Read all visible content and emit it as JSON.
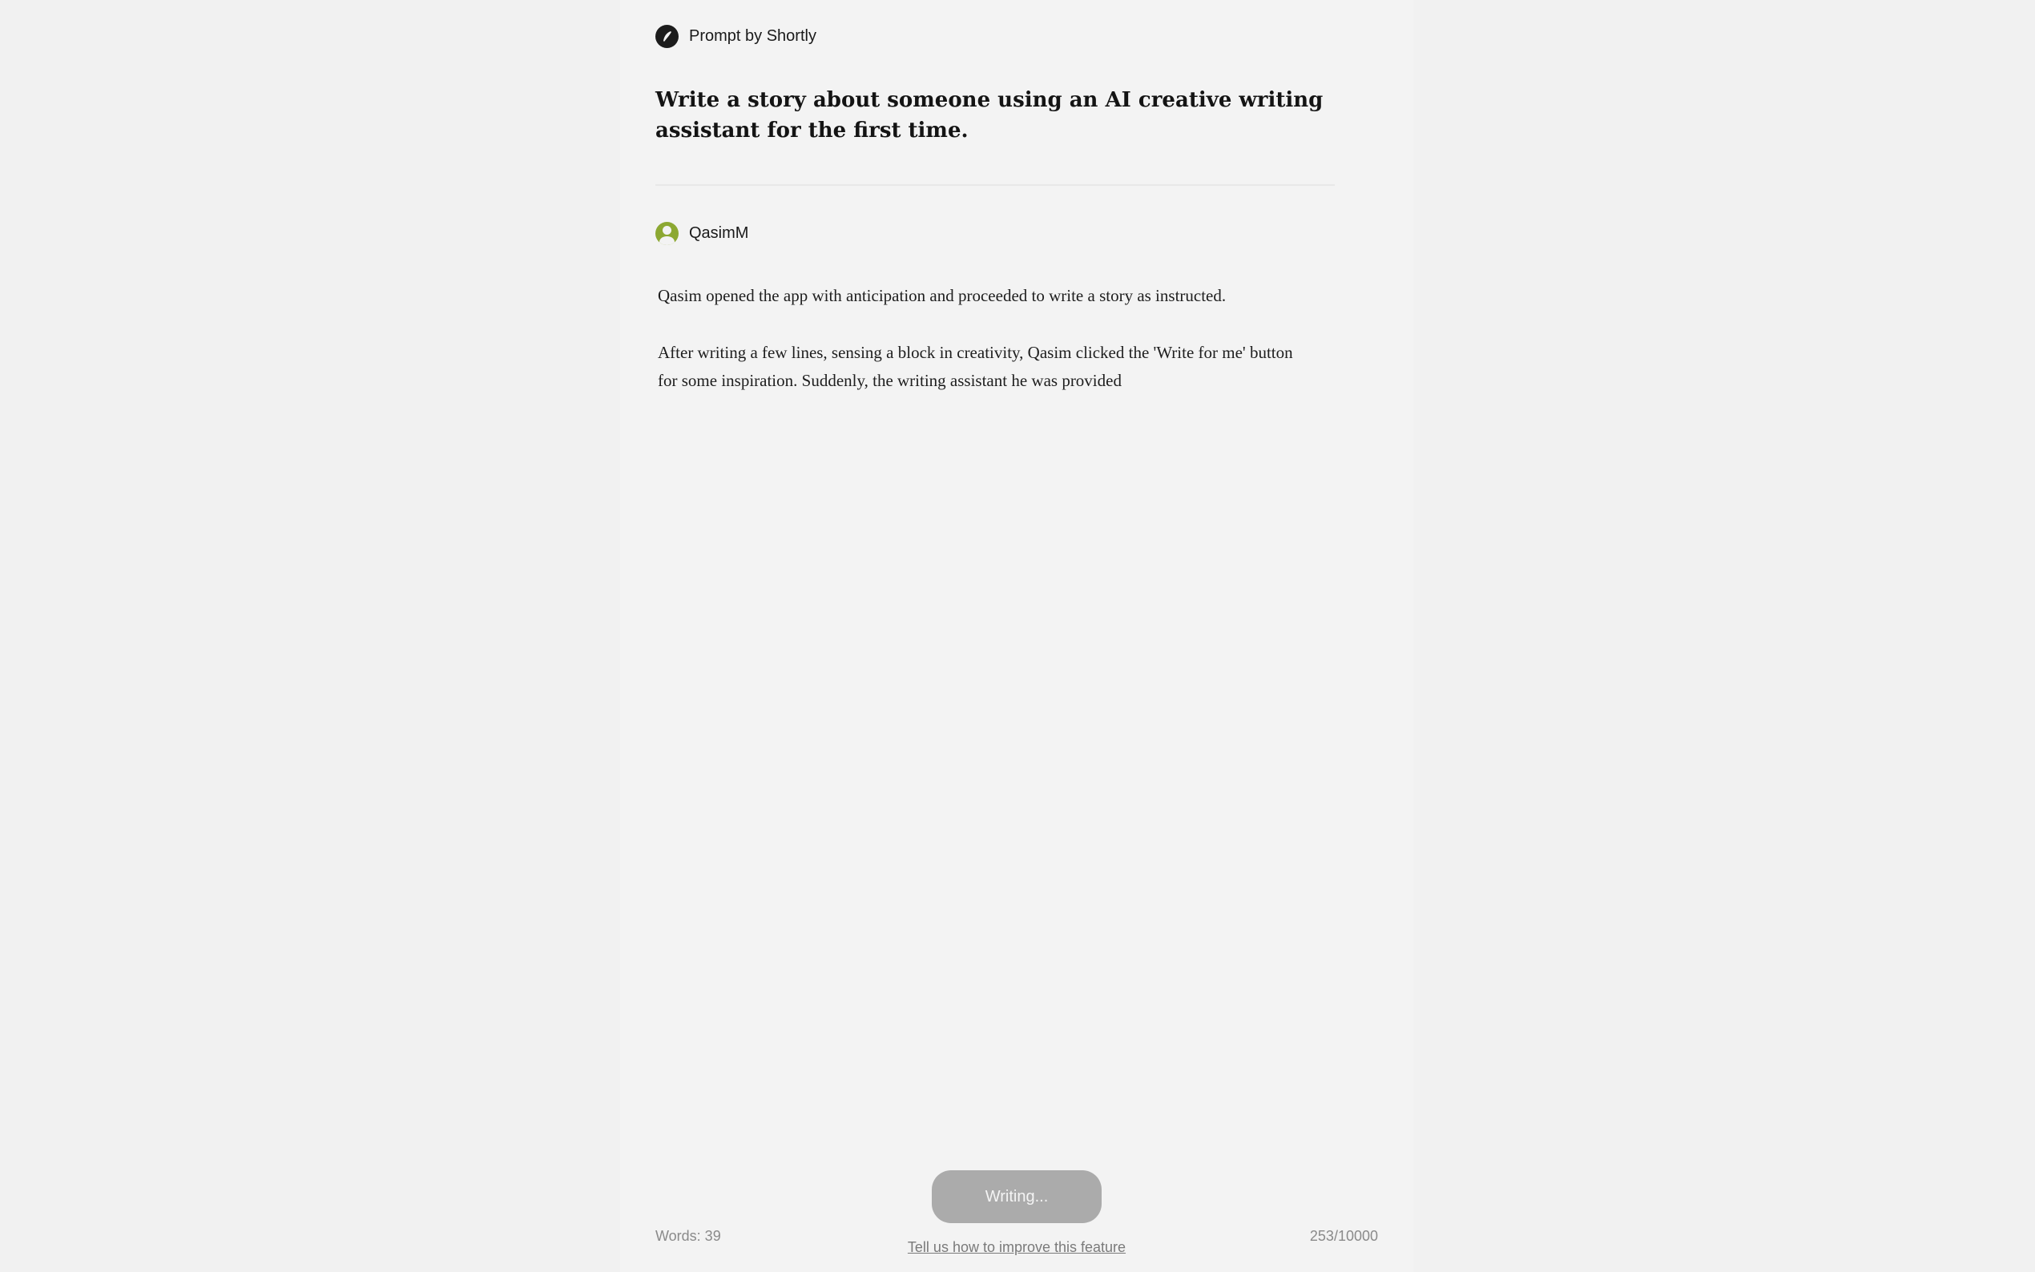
{
  "header": {
    "title": "Prompt by Shortly",
    "icon": "quill-icon"
  },
  "prompt": {
    "title": "Write a story about someone using an AI creative writing assistant for the first time."
  },
  "author": {
    "name": "QasimM",
    "avatar_icon": "user-avatar-icon",
    "avatar_color": "#8ca832"
  },
  "story": {
    "paragraphs": [
      "Qasim opened the app with anticipation and proceeded to write a story as instructed.",
      "After writing a few lines, sensing a block in creativity, Qasim clicked the 'Write for me' button for some inspiration. Suddenly, the writing assistant he was provided"
    ]
  },
  "footer": {
    "button_label": "Writing...",
    "word_count": "Words: 39",
    "char_count": "253/10000",
    "feedback_link": "Tell us how to improve this feature"
  },
  "colors": {
    "background": "#f1f1f1",
    "panel": "#f3f3f3",
    "button_disabled": "#ababab"
  }
}
